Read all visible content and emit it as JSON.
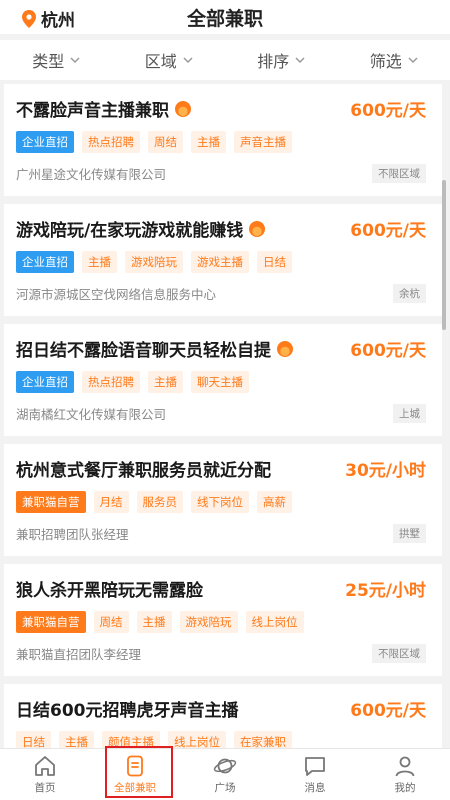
{
  "header": {
    "location": "杭州",
    "title": "全部兼职"
  },
  "filters": [
    {
      "label": "类型"
    },
    {
      "label": "区域"
    },
    {
      "label": "排序"
    },
    {
      "label": "筛选"
    }
  ],
  "jobs": [
    {
      "title": "不露脸声音主播兼职",
      "hot": true,
      "salary": "600元/天",
      "tags": [
        {
          "text": "企业直招",
          "style": "blue"
        },
        {
          "text": "热点招聘"
        },
        {
          "text": "周结"
        },
        {
          "text": "主播"
        },
        {
          "text": "声音主播"
        }
      ],
      "company": "广州星途文化传媒有限公司",
      "area": "不限区域"
    },
    {
      "title": "游戏陪玩/在家玩游戏就能赚钱",
      "hot": true,
      "salary": "600元/天",
      "tags": [
        {
          "text": "企业直招",
          "style": "blue"
        },
        {
          "text": "主播"
        },
        {
          "text": "游戏陪玩"
        },
        {
          "text": "游戏主播"
        },
        {
          "text": "日结"
        }
      ],
      "company": "河源市源城区空伐网络信息服务中心",
      "area": "余杭"
    },
    {
      "title": "招日结不露脸语音聊天员轻松自提",
      "hot": true,
      "salary": "600元/天",
      "tags": [
        {
          "text": "企业直招",
          "style": "blue"
        },
        {
          "text": "热点招聘"
        },
        {
          "text": "主播"
        },
        {
          "text": "聊天主播"
        }
      ],
      "company": "湖南橘红文化传媒有限公司",
      "area": "上城"
    },
    {
      "title": "杭州意式餐厅兼职服务员就近分配",
      "hot": false,
      "salary": "30元/小时",
      "tags": [
        {
          "text": "兼职猫自营",
          "style": "orange"
        },
        {
          "text": "月结"
        },
        {
          "text": "服务员"
        },
        {
          "text": "线下岗位"
        },
        {
          "text": "高薪"
        }
      ],
      "company": "兼职招聘团队张经理",
      "area": "拱墅"
    },
    {
      "title": "狼人杀开黑陪玩无需露脸",
      "hot": false,
      "salary": "25元/小时",
      "tags": [
        {
          "text": "兼职猫自营",
          "style": "orange"
        },
        {
          "text": "周结"
        },
        {
          "text": "主播"
        },
        {
          "text": "游戏陪玩"
        },
        {
          "text": "线上岗位"
        }
      ],
      "company": "兼职猫直招团队李经理",
      "area": "不限区域"
    },
    {
      "title": "日结600元招聘虎牙声音主播",
      "hot": false,
      "salary": "600元/天",
      "tags": [
        {
          "text": "日结"
        },
        {
          "text": "主播"
        },
        {
          "text": "颜值主播"
        },
        {
          "text": "线上岗位"
        },
        {
          "text": "在家兼职"
        }
      ],
      "company": "",
      "area": ""
    }
  ],
  "tabbar": [
    {
      "label": "首页",
      "icon": "home-icon"
    },
    {
      "label": "全部兼职",
      "icon": "document-icon",
      "active": true
    },
    {
      "label": "广场",
      "icon": "planet-icon"
    },
    {
      "label": "消息",
      "icon": "message-icon"
    },
    {
      "label": "我的",
      "icon": "user-icon"
    }
  ],
  "colors": {
    "accent": "#ff7a1a",
    "blue_tag": "#2e9cf0",
    "highlight": "#e02020"
  }
}
